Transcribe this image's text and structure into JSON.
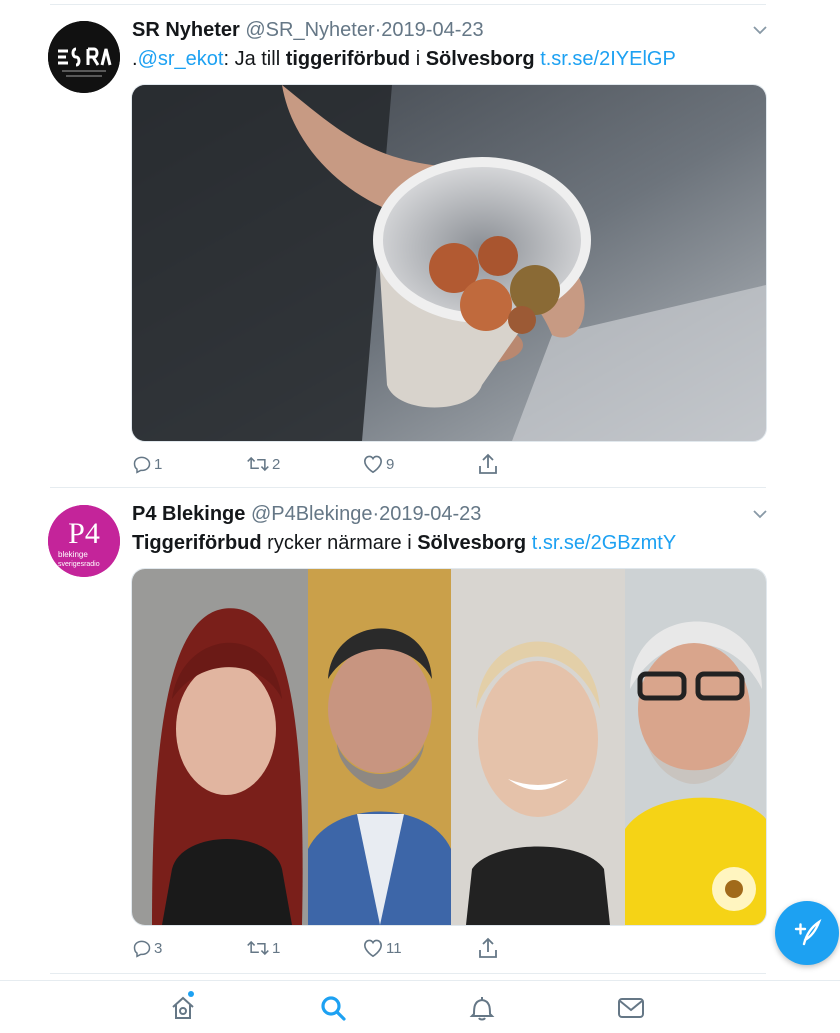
{
  "tweets": [
    {
      "name": "SR Nyheter",
      "handle": "@SR_Nyheter",
      "separator": "·",
      "date": "2019-04-23",
      "text_parts": [
        ".",
        "@sr_ekot",
        ": Ja till ",
        "tiggeriförbud",
        " i ",
        "Sölvesborg",
        " ",
        "t.sr.se/2IYElGP"
      ],
      "replies": "1",
      "retweets": "2",
      "likes": "9"
    },
    {
      "name": "P4 Blekinge",
      "handle": "@P4Blekinge",
      "separator": "·",
      "date": "2019-04-23",
      "text_parts": [
        "Tiggeriförbud",
        " rycker närmare i ",
        "Sölvesborg",
        " ",
        "t.sr.se/2GBzmtY"
      ],
      "avatar_text": "P4",
      "avatar_subtext": [
        "blekinge",
        "sverigesradio"
      ],
      "replies": "3",
      "retweets": "1",
      "likes": "11"
    }
  ],
  "colors": {
    "accent": "#1da1f2",
    "muted": "#657786",
    "text": "#14171a",
    "p4_brand": "#c4249a"
  },
  "icons": {
    "chevron": "chevron-down-icon",
    "reply": "reply-icon",
    "retweet": "retweet-icon",
    "like": "heart-icon",
    "share": "share-icon",
    "compose": "compose-tweet-icon",
    "tabs": [
      "home-icon",
      "search-icon",
      "notifications-icon",
      "messages-icon"
    ]
  }
}
